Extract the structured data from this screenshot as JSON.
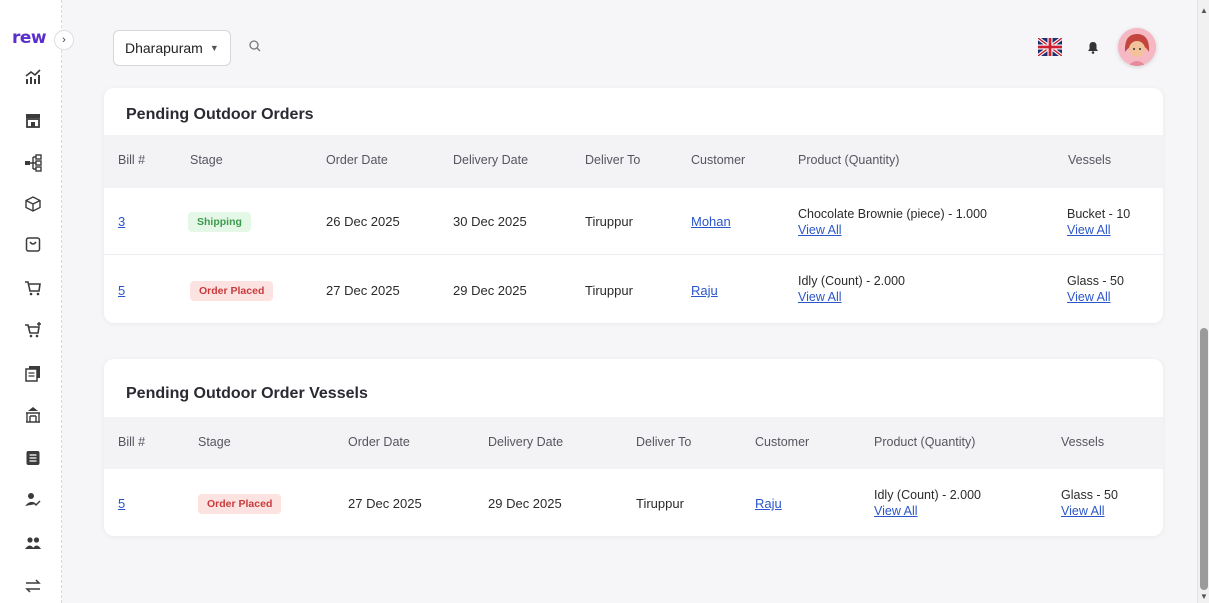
{
  "app": {
    "logo_text": "rew"
  },
  "sidebar": {
    "items": [
      {
        "icon": "analytics-icon"
      },
      {
        "icon": "store-icon"
      },
      {
        "icon": "hierarchy-icon"
      },
      {
        "icon": "box-icon"
      },
      {
        "icon": "bag-icon"
      },
      {
        "icon": "cart-icon"
      },
      {
        "icon": "cart-add-icon"
      },
      {
        "icon": "documents-icon"
      },
      {
        "icon": "outlet-icon"
      },
      {
        "icon": "ledger-icon"
      },
      {
        "icon": "user-check-icon"
      },
      {
        "icon": "users-icon"
      },
      {
        "icon": "transfer-icon"
      }
    ]
  },
  "header": {
    "branch": "Dharapuram",
    "search_icon": "search-icon",
    "language_icon": "uk-flag-icon",
    "notification_icon": "bell-icon"
  },
  "orders": {
    "title": "Pending Outdoor Orders",
    "columns": [
      "Bill #",
      "Stage",
      "Order Date",
      "Delivery Date",
      "Deliver To",
      "Customer",
      "Product (Quantity)",
      "Vessels"
    ],
    "rows": [
      {
        "bill": "3",
        "stage": "Shipping",
        "order_date": "26 Dec 2025",
        "delivery_date": "30 Dec 2025",
        "deliver_to": "Tiruppur",
        "customer": "Mohan",
        "product": "Chocolate Brownie (piece) - 1.000",
        "product_link": "View All",
        "vessels": "Bucket - 10",
        "vessels_link": "View All"
      },
      {
        "bill": "5",
        "stage": "Order Placed",
        "order_date": "27 Dec 2025",
        "delivery_date": "29 Dec 2025",
        "deliver_to": "Tiruppur",
        "customer": "Raju",
        "product": "Idly (Count) - 2.000",
        "product_link": "View All",
        "vessels": "Glass - 50",
        "vessels_link": "View All"
      }
    ]
  },
  "vessels": {
    "title": "Pending Outdoor Order Vessels",
    "columns": [
      "Bill #",
      "Stage",
      "Order Date",
      "Delivery Date",
      "Deliver To",
      "Customer",
      "Product (Quantity)",
      "Vessels"
    ],
    "rows": [
      {
        "bill": "5",
        "stage": "Order Placed",
        "order_date": "27 Dec 2025",
        "delivery_date": "29 Dec 2025",
        "deliver_to": "Tiruppur",
        "customer": "Raju",
        "product": "Idly (Count) - 2.000",
        "product_link": "View All",
        "vessels": "Glass - 50",
        "vessels_link": "View All"
      }
    ]
  },
  "colors": {
    "accent": "#5b2ecc",
    "link": "#2b56c9",
    "shipping_bg": "#e5f7e7",
    "shipping_fg": "#3c9a4c",
    "placed_bg": "#fde2e2",
    "placed_fg": "#c93b3b"
  }
}
